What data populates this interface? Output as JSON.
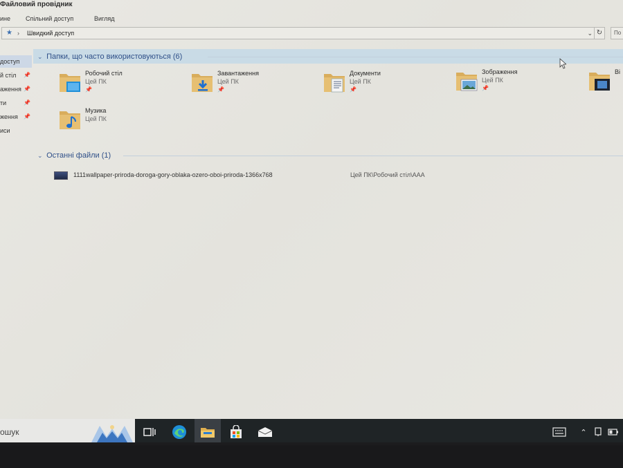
{
  "window": {
    "title": "Файловий провідник"
  },
  "menu": {
    "items": [
      "ине",
      "Спільний доступ",
      "Вигляд"
    ]
  },
  "address": {
    "path": "Швидкий доступ",
    "search_placeholder": "По"
  },
  "nav": {
    "items": [
      {
        "label": "доступ",
        "pinned": false
      },
      {
        "label": "й стіл",
        "pinned": true
      },
      {
        "label": "аження",
        "pinned": true
      },
      {
        "label": "ти",
        "pinned": true
      },
      {
        "label": "ження",
        "pinned": true
      },
      {
        "label": "иси",
        "pinned": false
      }
    ]
  },
  "frequent": {
    "header": "Папки, що часто використовуються (6)",
    "folders": [
      {
        "name": "Робочий стіл",
        "location": "Цей ПК",
        "pinned": true,
        "icon": "desktop-folder-icon"
      },
      {
        "name": "Завантаження",
        "location": "Цей ПК",
        "pinned": true,
        "icon": "downloads-folder-icon"
      },
      {
        "name": "Документи",
        "location": "Цей ПК",
        "pinned": true,
        "icon": "documents-folder-icon"
      },
      {
        "name": "Зображення",
        "location": "Цей ПК",
        "pinned": true,
        "icon": "pictures-folder-icon"
      },
      {
        "name": "Ві",
        "location": "",
        "pinned": false,
        "icon": "videos-folder-icon"
      },
      {
        "name": "Музика",
        "location": "Цей ПК",
        "pinned": false,
        "icon": "music-folder-icon"
      }
    ]
  },
  "recent": {
    "header": "Останні файли (1)",
    "files": [
      {
        "name": "1111wallpaper-priroda-doroga-gory-oblaka-ozero-oboi-priroda-1366x768",
        "path": "Цей ПК\\Робочий стіл\\ААА"
      }
    ]
  },
  "taskbar": {
    "search_text": "ошук",
    "apps": [
      "task-view-icon",
      "edge-icon",
      "file-explorer-icon",
      "store-icon",
      "mail-icon"
    ],
    "active_app": "file-explorer-icon"
  },
  "colors": {
    "accent": "#3c6fb0",
    "folder": "#e0b867",
    "group_band": "#c9dbe6",
    "taskbar": "#1f2426"
  }
}
